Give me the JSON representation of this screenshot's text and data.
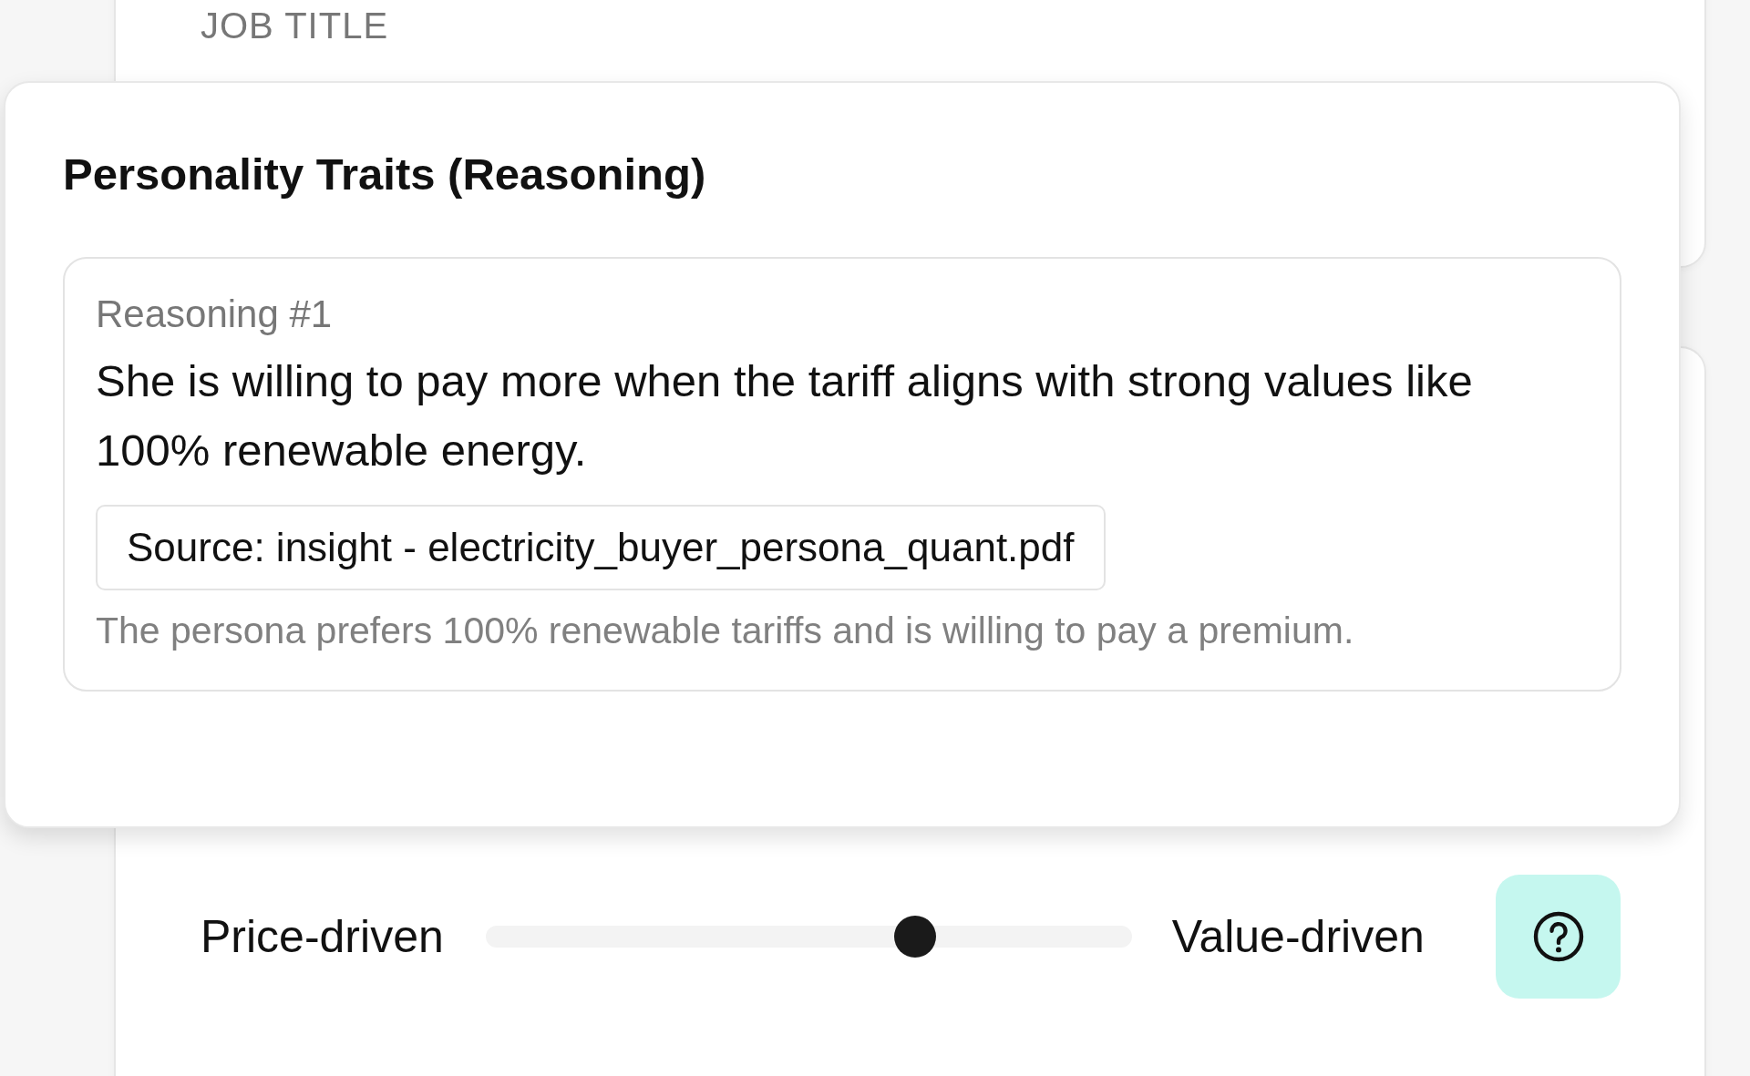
{
  "background_card": {
    "field_label": "JOB TITLE"
  },
  "popover": {
    "title": "Personality Traits (Reasoning)",
    "reasonings": [
      {
        "label": "Reasoning #1",
        "text": "She is willing to pay more when the tariff aligns with strong values like 100% renewable energy.",
        "source": "Source: insight - electricity_buyer_persona_quant.pdf",
        "excerpt": "The persona prefers 100% renewable tariffs and is willing to pay a premium."
      }
    ]
  },
  "trait_slider": {
    "left_label": "Price-driven",
    "right_label": "Value-driven",
    "level": 0.665
  }
}
